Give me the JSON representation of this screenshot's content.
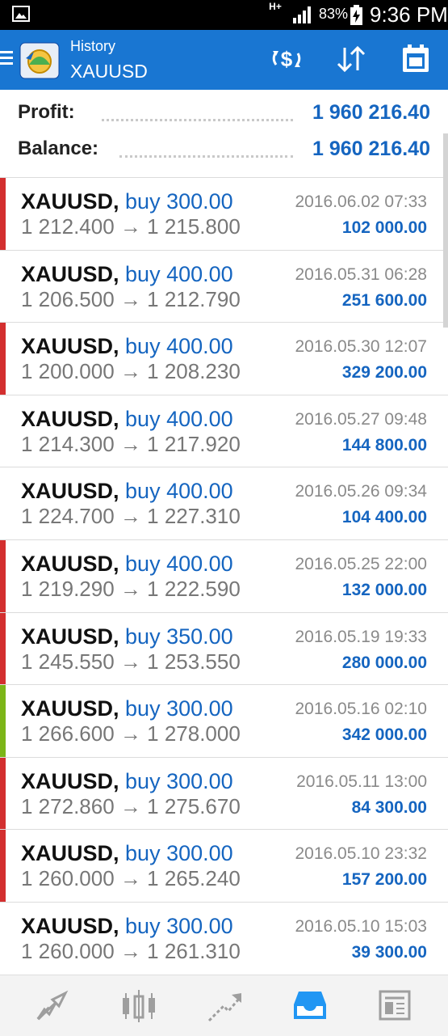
{
  "status_bar": {
    "network": "H+",
    "battery_percent": "83%",
    "time": "9:36 PM",
    "icons": [
      "image-icon",
      "signal-icon",
      "battery-charging-icon"
    ]
  },
  "header": {
    "subtitle": "History",
    "title": "XAUUSD",
    "actions": [
      "currency-swap-icon",
      "sort-icon",
      "calendar-icon"
    ],
    "accent": "#1976d2"
  },
  "summary": {
    "profit_label": "Profit:",
    "profit_value": "1 960 216.40",
    "balance_label": "Balance:",
    "balance_value": "1 960 216.40"
  },
  "trades": [
    {
      "symbol": "XAUUSD,",
      "direction": "buy 300.00",
      "open": "1 212.400",
      "close": "1 215.800",
      "arrow": "→",
      "time": "2016.06.02 07:33",
      "profit": "102 000.00",
      "marker": "#d32f2f"
    },
    {
      "symbol": "XAUUSD,",
      "direction": "buy 400.00",
      "open": "1 206.500",
      "close": "1 212.790",
      "arrow": "→",
      "time": "2016.05.31 06:28",
      "profit": "251 600.00",
      "marker": ""
    },
    {
      "symbol": "XAUUSD,",
      "direction": "buy 400.00",
      "open": "1 200.000",
      "close": "1 208.230",
      "arrow": "→",
      "time": "2016.05.30 12:07",
      "profit": "329 200.00",
      "marker": "#d32f2f"
    },
    {
      "symbol": "XAUUSD,",
      "direction": "buy 400.00",
      "open": "1 214.300",
      "close": "1 217.920",
      "arrow": "→",
      "time": "2016.05.27 09:48",
      "profit": "144 800.00",
      "marker": ""
    },
    {
      "symbol": "XAUUSD,",
      "direction": "buy 400.00",
      "open": "1 224.700",
      "close": "1 227.310",
      "arrow": "→",
      "time": "2016.05.26 09:34",
      "profit": "104 400.00",
      "marker": ""
    },
    {
      "symbol": "XAUUSD,",
      "direction": "buy 400.00",
      "open": "1 219.290",
      "close": "1 222.590",
      "arrow": "→",
      "time": "2016.05.25 22:00",
      "profit": "132 000.00",
      "marker": "#d32f2f"
    },
    {
      "symbol": "XAUUSD,",
      "direction": "buy 350.00",
      "open": "1 245.550",
      "close": "1 253.550",
      "arrow": "→",
      "time": "2016.05.19 19:33",
      "profit": "280 000.00",
      "marker": "#d32f2f"
    },
    {
      "symbol": "XAUUSD,",
      "direction": "buy 300.00",
      "open": "1 266.600",
      "close": "1 278.000",
      "arrow": "→",
      "time": "2016.05.16 02:10",
      "profit": "342 000.00",
      "marker": "#7cb518"
    },
    {
      "symbol": "XAUUSD,",
      "direction": "buy 300.00",
      "open": "1 272.860",
      "close": "1 275.670",
      "arrow": "→",
      "time": "2016.05.11 13:00",
      "profit": "84 300.00",
      "marker": "#d32f2f"
    },
    {
      "symbol": "XAUUSD,",
      "direction": "buy 300.00",
      "open": "1 260.000",
      "close": "1 265.240",
      "arrow": "→",
      "time": "2016.05.10 23:32",
      "profit": "157 200.00",
      "marker": "#d32f2f"
    },
    {
      "symbol": "XAUUSD,",
      "direction": "buy 300.00",
      "open": "1 260.000",
      "close": "1 261.310",
      "arrow": "→",
      "time": "2016.05.10 15:03",
      "profit": "39 300.00",
      "marker": ""
    }
  ],
  "bottom_nav": {
    "items": [
      "quotes-icon",
      "chart-icon",
      "trade-icon",
      "history-icon",
      "news-icon"
    ],
    "active": "history-icon",
    "active_color": "#2196f3",
    "inactive_color": "#9e9e9e"
  }
}
